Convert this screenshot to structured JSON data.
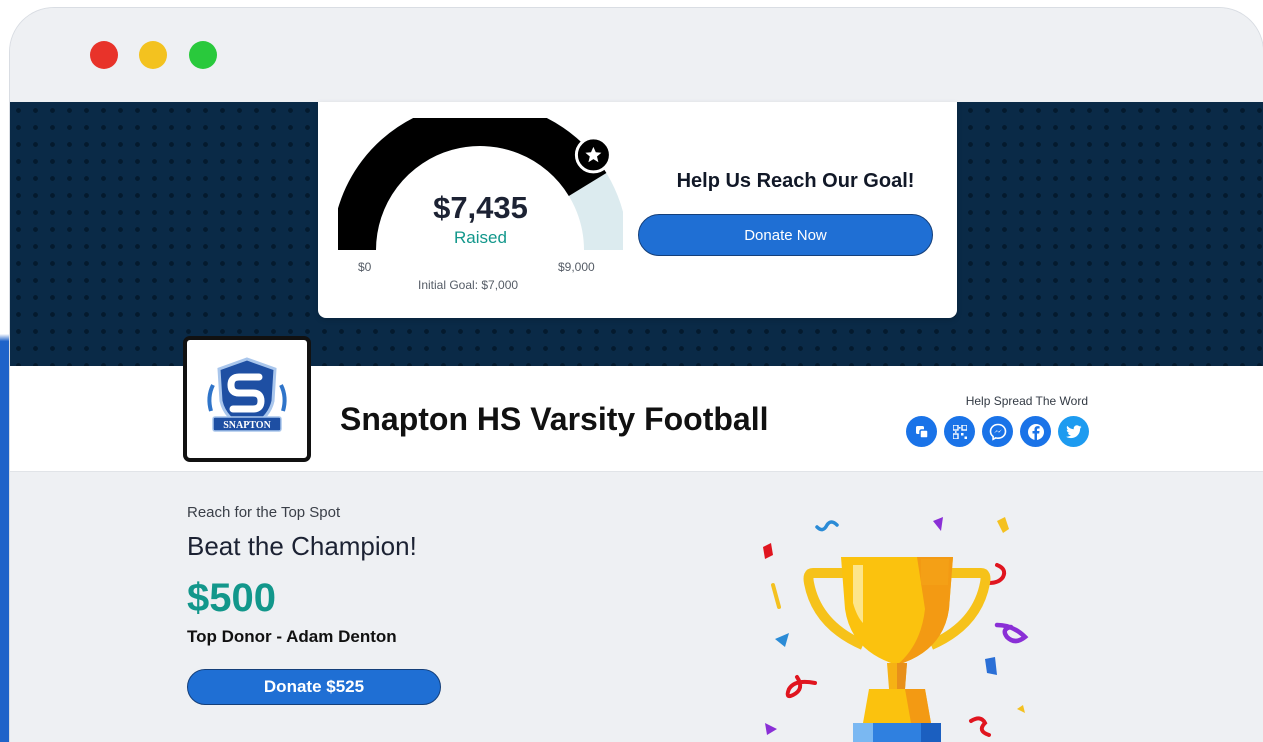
{
  "window": {
    "controls": [
      "close",
      "minimize",
      "maximize"
    ],
    "colors": {
      "close": "#e8332a",
      "minimize": "#f3c21f",
      "maximize": "#29c93c"
    }
  },
  "goal": {
    "raised_amount": "$7,435",
    "raised_label": "Raised",
    "min_label": "$0",
    "max_label": "$9,000",
    "initial_goal": "Initial Goal: $7,000",
    "progress_fraction": 0.826,
    "initial_goal_fraction": 0.778,
    "marker_icon": "star-icon",
    "help_title": "Help Us Reach Our Goal!",
    "donate_button": "Donate Now"
  },
  "team": {
    "name": "Snapton HS Varsity Football",
    "logo_text": "SNAPTON",
    "share_label": "Help Spread The Word",
    "share_icons": [
      "copy-icon",
      "qr-code-icon",
      "messenger-icon",
      "facebook-icon",
      "twitter-icon"
    ]
  },
  "champion": {
    "reach_label": "Reach for the Top Spot",
    "title": "Beat the Champion!",
    "top_amount": "$500",
    "top_donor": "Top Donor - Adam Denton",
    "donate_button": "Donate $525",
    "illustration": "trophy-icon"
  },
  "colors": {
    "accent": "#1f6fd4",
    "teal": "#12978b",
    "hero_bg": "#0a2a47"
  }
}
